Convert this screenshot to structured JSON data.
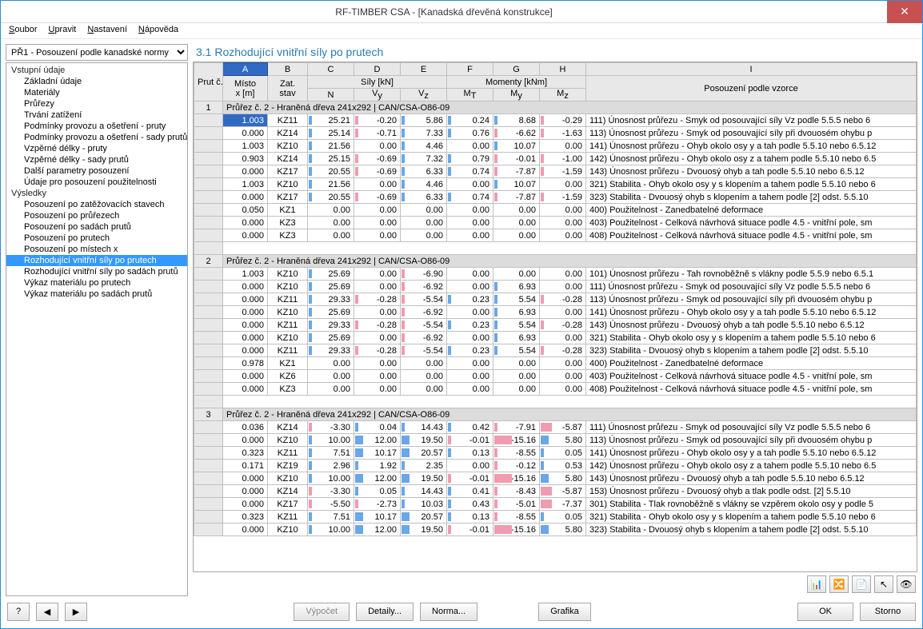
{
  "window": {
    "title": "RF-TIMBER CSA - [Kanadská dřevěná konstrukce]"
  },
  "menu": {
    "file": "Soubor",
    "edit": "Upravit",
    "settings": "Nastavení",
    "help": "Nápověda"
  },
  "combo": {
    "value": "PŘ1 - Posouzení podle kanadské normy"
  },
  "tree": {
    "g1": "Vstupní údaje",
    "i1": "Základní údaje",
    "i2": "Materiály",
    "i3": "Průřezy",
    "i4": "Trvání zatížení",
    "i5": "Podmínky provozu a ošetření - pruty",
    "i6": "Podmínky provozu a ošetření - sady prutů",
    "i7": "Vzpěrné délky - pruty",
    "i8": "Vzpěrné délky - sady prutů",
    "i9": "Další parametry posouzení",
    "i10": "Údaje pro posouzení použitelnosti",
    "g2": "Výsledky",
    "r1": "Posouzení po zatěžovacích stavech",
    "r2": "Posouzení po průřezech",
    "r3": "Posouzení po sadách prutů",
    "r4": "Posouzení po prutech",
    "r5": "Posouzení po místech x",
    "r6": "Rozhodující vnitřní síly po prutech",
    "r7": "Rozhodující vnitřní síly po sadách prutů",
    "r8": "Výkaz materiálu po prutech",
    "r9": "Výkaz materiálu po sadách prutů"
  },
  "section": {
    "title": "3.1  Rozhodující vnitřní síly po prutech"
  },
  "cols": {
    "letters": [
      "A",
      "B",
      "C",
      "D",
      "E",
      "F",
      "G",
      "H",
      "I"
    ],
    "prutc": "Prut č.",
    "misto": "Místo x [m]",
    "zat": "Zat. stav",
    "sily": "Síly [kN]",
    "N": "N",
    "Vy": "Vy",
    "Vz": "Vz",
    "mom": "Momenty [kNm]",
    "MT": "MT",
    "My": "My",
    "Mz": "Mz",
    "pos": "Posouzení podle vzorce"
  },
  "groups": {
    "g1": "Průřez č.  2 - Hraněná dřeva 241x292 | CAN/CSA-O86-09",
    "g2": "Průřez č.  2 - Hraněná dřeva 241x292 | CAN/CSA-O86-09",
    "g3": "Průřez č.  2 - Hraněná dřeva 241x292 | CAN/CSA-O86-09"
  },
  "rows1": [
    {
      "x": "1.003",
      "z": "KZ11",
      "N": "25.21",
      "Vy": "-0.20",
      "Vz": "5.86",
      "MT": "0.24",
      "My": "8.68",
      "Mz": "-0.29",
      "t": "111) Únosnost průřezu - Smyk od posouvající síly Vz podle 5.5.5 nebo 6"
    },
    {
      "x": "0.000",
      "z": "KZ14",
      "N": "25.14",
      "Vy": "-0.71",
      "Vz": "7.33",
      "MT": "0.76",
      "My": "-6.62",
      "Mz": "-1.63",
      "t": "113) Únosnost průřezu - Smyk od posouvající síly při dvouosém ohybu p"
    },
    {
      "x": "1.003",
      "z": "KZ10",
      "N": "21.56",
      "Vy": "0.00",
      "Vz": "4.46",
      "MT": "0.00",
      "My": "10.07",
      "Mz": "0.00",
      "t": "141) Únosnost průřezu - Ohyb okolo osy y a tah podle 5.5.10 nebo 6.5.12"
    },
    {
      "x": "0.903",
      "z": "KZ14",
      "N": "25.15",
      "Vy": "-0.69",
      "Vz": "7.32",
      "MT": "0.79",
      "My": "-0.01",
      "Mz": "-1.00",
      "t": "142) Únosnost průřezu - Ohyb okolo osy z a tahem podle 5.5.10 nebo 6.5"
    },
    {
      "x": "0.000",
      "z": "KZ17",
      "N": "20.55",
      "Vy": "-0.69",
      "Vz": "6.33",
      "MT": "0.74",
      "My": "-7.87",
      "Mz": "-1.59",
      "t": "143) Únosnost průřezu - Dvouosý ohyb a tah podle 5.5.10 nebo 6.5.12"
    },
    {
      "x": "1.003",
      "z": "KZ10",
      "N": "21.56",
      "Vy": "0.00",
      "Vz": "4.46",
      "MT": "0.00",
      "My": "10.07",
      "Mz": "0.00",
      "t": "321) Stabilita - Ohyb okolo osy y s klopením a tahem podle 5.5.10 nebo 6"
    },
    {
      "x": "0.000",
      "z": "KZ17",
      "N": "20.55",
      "Vy": "-0.69",
      "Vz": "6.33",
      "MT": "0.74",
      "My": "-7.87",
      "Mz": "-1.59",
      "t": "323) Stabilita - Dvouosý ohyb s klopením a tahem podle [2] odst. 5.5.10"
    },
    {
      "x": "0.050",
      "z": "KZ1",
      "N": "0.00",
      "Vy": "0.00",
      "Vz": "0.00",
      "MT": "0.00",
      "My": "0.00",
      "Mz": "0.00",
      "t": "400) Použitelnost - Zanedbatelné deformace"
    },
    {
      "x": "0.000",
      "z": "KZ3",
      "N": "0.00",
      "Vy": "0.00",
      "Vz": "0.00",
      "MT": "0.00",
      "My": "0.00",
      "Mz": "0.00",
      "t": "403) Použitelnost - Celková návrhová situace podle 4.5 - vnitřní pole, sm"
    },
    {
      "x": "0.000",
      "z": "KZ3",
      "N": "0.00",
      "Vy": "0.00",
      "Vz": "0.00",
      "MT": "0.00",
      "My": "0.00",
      "Mz": "0.00",
      "t": "408) Použitelnost - Celková návrhová situace podle 4.5 - vnitřní pole, sm"
    }
  ],
  "rows2": [
    {
      "x": "1.003",
      "z": "KZ10",
      "N": "25.69",
      "Vy": "0.00",
      "Vz": "-6.90",
      "MT": "0.00",
      "My": "0.00",
      "Mz": "0.00",
      "t": "101) Únosnost průřezu - Tah rovnoběžně s vlákny podle 5.5.9 nebo 6.5.1"
    },
    {
      "x": "0.000",
      "z": "KZ10",
      "N": "25.69",
      "Vy": "0.00",
      "Vz": "-6.92",
      "MT": "0.00",
      "My": "6.93",
      "Mz": "0.00",
      "t": "111) Únosnost průřezu - Smyk od posouvající síly Vz podle 5.5.5 nebo 6"
    },
    {
      "x": "0.000",
      "z": "KZ11",
      "N": "29.33",
      "Vy": "-0.28",
      "Vz": "-5.54",
      "MT": "0.23",
      "My": "5.54",
      "Mz": "-0.28",
      "t": "113) Únosnost průřezu - Smyk od posouvající síly při dvouosém ohybu p"
    },
    {
      "x": "0.000",
      "z": "KZ10",
      "N": "25.69",
      "Vy": "0.00",
      "Vz": "-6.92",
      "MT": "0.00",
      "My": "6.93",
      "Mz": "0.00",
      "t": "141) Únosnost průřezu - Ohyb okolo osy y a tah podle 5.5.10 nebo 6.5.12"
    },
    {
      "x": "0.000",
      "z": "KZ11",
      "N": "29.33",
      "Vy": "-0.28",
      "Vz": "-5.54",
      "MT": "0.23",
      "My": "5.54",
      "Mz": "-0.28",
      "t": "143) Únosnost průřezu - Dvouosý ohyb a tah podle 5.5.10 nebo 6.5.12"
    },
    {
      "x": "0.000",
      "z": "KZ10",
      "N": "25.69",
      "Vy": "0.00",
      "Vz": "-6.92",
      "MT": "0.00",
      "My": "6.93",
      "Mz": "0.00",
      "t": "321) Stabilita - Ohyb okolo osy y s klopením a tahem podle 5.5.10 nebo 6"
    },
    {
      "x": "0.000",
      "z": "KZ11",
      "N": "29.33",
      "Vy": "-0.28",
      "Vz": "-5.54",
      "MT": "0.23",
      "My": "5.54",
      "Mz": "-0.28",
      "t": "323) Stabilita - Dvouosý ohyb s klopením a tahem podle [2] odst. 5.5.10"
    },
    {
      "x": "0.978",
      "z": "KZ1",
      "N": "0.00",
      "Vy": "0.00",
      "Vz": "0.00",
      "MT": "0.00",
      "My": "0.00",
      "Mz": "0.00",
      "t": "400) Použitelnost - Zanedbatelné deformace"
    },
    {
      "x": "0.000",
      "z": "KZ6",
      "N": "0.00",
      "Vy": "0.00",
      "Vz": "0.00",
      "MT": "0.00",
      "My": "0.00",
      "Mz": "0.00",
      "t": "403) Použitelnost - Celková návrhová situace podle 4.5 - vnitřní pole, sm"
    },
    {
      "x": "0.000",
      "z": "KZ3",
      "N": "0.00",
      "Vy": "0.00",
      "Vz": "0.00",
      "MT": "0.00",
      "My": "0.00",
      "Mz": "0.00",
      "t": "408) Použitelnost - Celková návrhová situace podle 4.5 - vnitřní pole, sm"
    }
  ],
  "rows3": [
    {
      "x": "0.036",
      "z": "KZ14",
      "N": "-3.30",
      "Vy": "0.04",
      "Vz": "14.43",
      "MT": "0.42",
      "My": "-7.91",
      "Mz": "-5.87",
      "t": "111) Únosnost průřezu - Smyk od posouvající síly Vz podle 5.5.5 nebo 6"
    },
    {
      "x": "0.000",
      "z": "KZ10",
      "N": "10.00",
      "Vy": "12.00",
      "Vz": "19.50",
      "MT": "-0.01",
      "My": "-15.16",
      "Mz": "5.80",
      "t": "113) Únosnost průřezu - Smyk od posouvající síly při dvouosém ohybu p"
    },
    {
      "x": "0.323",
      "z": "KZ11",
      "N": "7.51",
      "Vy": "10.17",
      "Vz": "20.57",
      "MT": "0.13",
      "My": "-8.55",
      "Mz": "0.05",
      "t": "141) Únosnost průřezu - Ohyb okolo osy y a tah podle 5.5.10 nebo 6.5.12"
    },
    {
      "x": "0.171",
      "z": "KZ19",
      "N": "2.96",
      "Vy": "1.92",
      "Vz": "2.35",
      "MT": "0.00",
      "My": "-0.12",
      "Mz": "0.53",
      "t": "142) Únosnost průřezu - Ohyb okolo osy z a tahem podle 5.5.10 nebo 6.5"
    },
    {
      "x": "0.000",
      "z": "KZ10",
      "N": "10.00",
      "Vy": "12.00",
      "Vz": "19.50",
      "MT": "-0.01",
      "My": "-15.16",
      "Mz": "5.80",
      "t": "143) Únosnost průřezu - Dvouosý ohyb a tah podle 5.5.10 nebo 6.5.12"
    },
    {
      "x": "0.000",
      "z": "KZ14",
      "N": "-3.30",
      "Vy": "0.05",
      "Vz": "14.43",
      "MT": "0.41",
      "My": "-8.43",
      "Mz": "-5.87",
      "t": "153) Únosnost průřezu - Dvouosý ohyb a tlak podle odst. [2] 5.5.10"
    },
    {
      "x": "0.000",
      "z": "KZ17",
      "N": "-5.50",
      "Vy": "-2.73",
      "Vz": "10.03",
      "MT": "0.43",
      "My": "-5.01",
      "Mz": "-7.37",
      "t": "301) Stabilita - Tlak rovnoběžně s vlákny se vzpěrem okolo osy y podle 5"
    },
    {
      "x": "0.323",
      "z": "KZ11",
      "N": "7.51",
      "Vy": "10.17",
      "Vz": "20.57",
      "MT": "0.13",
      "My": "-8.55",
      "Mz": "0.05",
      "t": "321) Stabilita - Ohyb okolo osy y s klopením a tahem podle 5.5.10 nebo 6"
    },
    {
      "x": "0.000",
      "z": "KZ10",
      "N": "10.00",
      "Vy": "12.00",
      "Vz": "19.50",
      "MT": "-0.01",
      "My": "-15.16",
      "Mz": "5.80",
      "t": "323) Stabilita - Dvouosý ohyb s klopením a tahem podle [2] odst. 5.5.10"
    }
  ],
  "footer": {
    "calc": "Výpočet",
    "details": "Detaily...",
    "norm": "Norma...",
    "graphics": "Grafika",
    "ok": "OK",
    "cancel": "Storno"
  }
}
